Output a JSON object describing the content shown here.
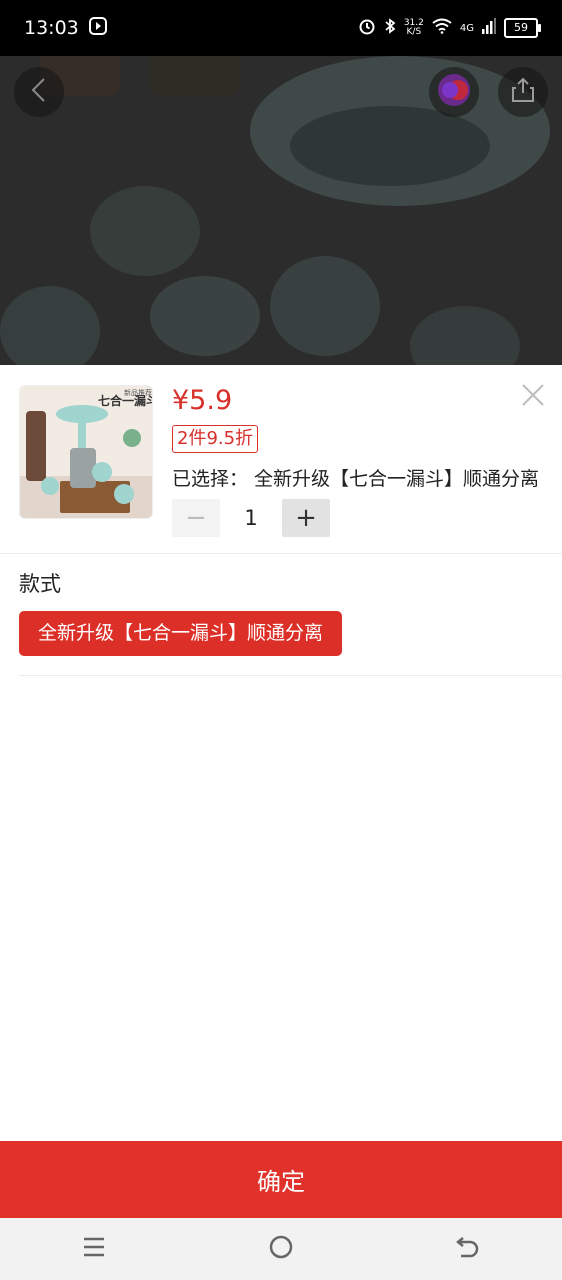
{
  "status_bar": {
    "time": "13:03",
    "net_speed_value": "31.2",
    "net_speed_unit": "K/S",
    "network": "4G",
    "battery": "59"
  },
  "icons": {
    "back": "chevron-left-icon",
    "cart": "cart-icon",
    "share": "share-icon",
    "close": "close-icon"
  },
  "thumbnail": {
    "tag": "新品推荐",
    "title": "七合一漏斗"
  },
  "product": {
    "price": "¥5.9",
    "promo": "2件9.5折",
    "selected_text": "已选择：  全新升级【七合一漏斗】顺通分离"
  },
  "quantity": {
    "minus": "−",
    "value": "1",
    "plus": "+"
  },
  "spec": {
    "title": "款式",
    "options": [
      {
        "label": "全新升级【七合一漏斗】顺通分离",
        "selected": true
      }
    ]
  },
  "confirm_label": "确定",
  "colors": {
    "accent": "#dc2f27",
    "confirm_bg": "#e0322a",
    "price": "#d8302b"
  }
}
